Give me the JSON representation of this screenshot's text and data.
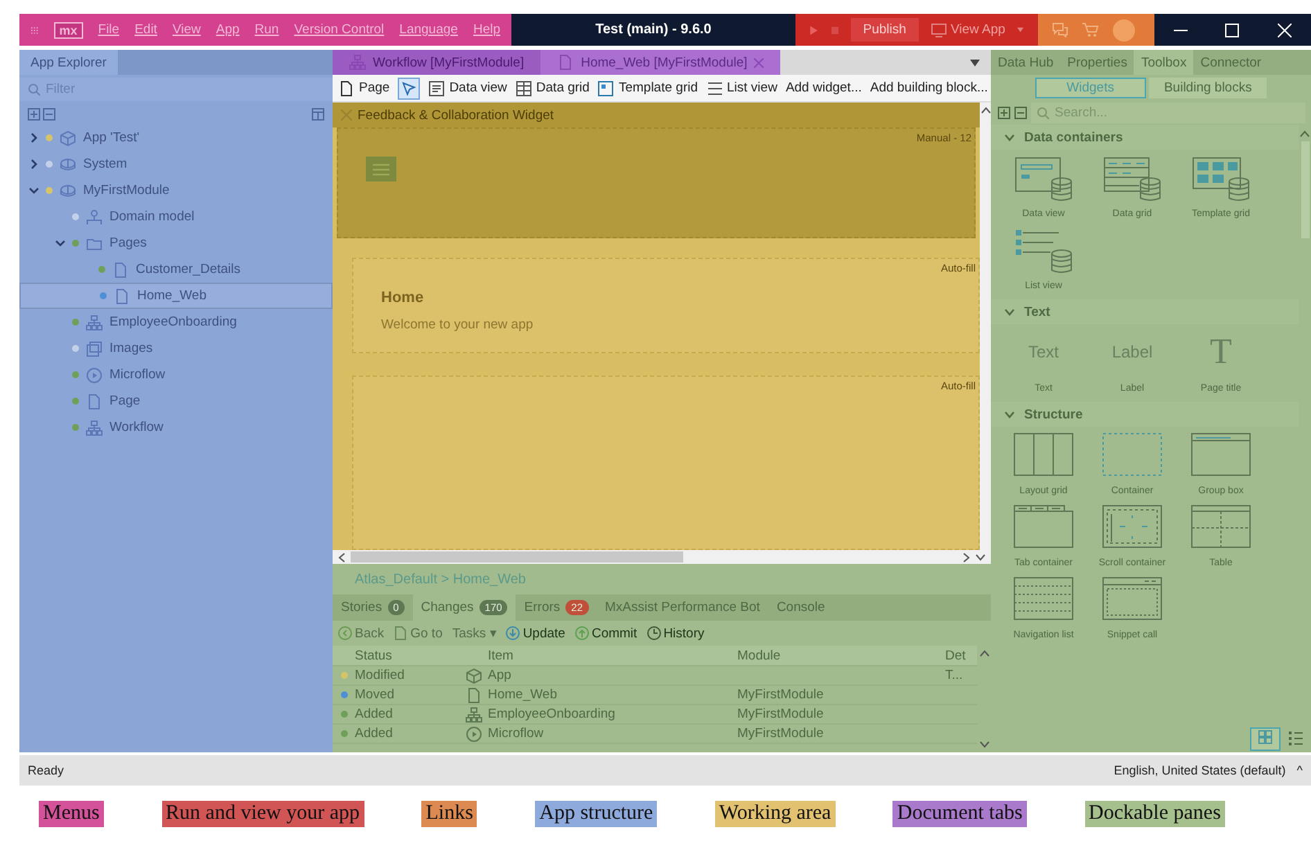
{
  "title_bar": {
    "logo": "mx",
    "menus": [
      "File",
      "Edit",
      "View",
      "App",
      "Run",
      "Version Control",
      "Language",
      "Help"
    ],
    "title": "Test (main)  -  9.6.0",
    "publish": "Publish",
    "view_app": "View App"
  },
  "app_explorer": {
    "title": "App Explorer",
    "filter_placeholder": "Filter",
    "tree": [
      {
        "label": "App 'Test'",
        "kind": "app",
        "color": "#d6c46a",
        "expanded": false,
        "selected": false
      },
      {
        "label": "System",
        "kind": "module",
        "color": "#c4cfe8",
        "expanded": false,
        "selected": false
      },
      {
        "label": "MyFirstModule",
        "kind": "module",
        "color": "#d6c46a",
        "expanded": true,
        "selected": false,
        "children": [
          {
            "label": "Domain model",
            "kind": "domain",
            "color": "#c4cfe8",
            "selected": false
          },
          {
            "label": "Pages",
            "kind": "folder",
            "color": "#6fa05a",
            "expanded": true,
            "selected": false,
            "children": [
              {
                "label": "Customer_Details",
                "kind": "page",
                "color": "#6fa05a",
                "selected": false
              },
              {
                "label": "Home_Web",
                "kind": "page",
                "color": "#4f8fd6",
                "selected": true
              }
            ]
          },
          {
            "label": "EmployeeOnboarding",
            "kind": "workflow",
            "color": "#6fa05a",
            "selected": false
          },
          {
            "label": "Images",
            "kind": "images",
            "color": "#c4cfe8",
            "selected": false
          },
          {
            "label": "Microflow",
            "kind": "microflow",
            "color": "#6fa05a",
            "selected": false
          },
          {
            "label": "Page",
            "kind": "page",
            "color": "#6fa05a",
            "selected": false
          },
          {
            "label": "Workflow",
            "kind": "workflow",
            "color": "#6fa05a",
            "selected": false
          }
        ]
      }
    ]
  },
  "document_tabs": [
    {
      "label": "Workflow [MyFirstModule]",
      "kind": "workflow",
      "selected": false
    },
    {
      "label": "Home_Web [MyFirstModule]",
      "kind": "page",
      "selected": true
    }
  ],
  "page_toolbar": [
    {
      "label": "Page",
      "kind": "page"
    },
    {
      "kind": "select"
    },
    {
      "label": "Data view",
      "kind": "dataview"
    },
    {
      "label": "Data grid",
      "kind": "datagrid"
    },
    {
      "label": "Template grid",
      "kind": "templategrid"
    },
    {
      "label": "List view",
      "kind": "listview"
    },
    {
      "label": "Add widget...",
      "kind": "text"
    },
    {
      "label": "Add building block...",
      "kind": "text"
    }
  ],
  "canvas": {
    "widget_bar": "Feedback & Collaboration Widget",
    "header_tag": "Manual - 12",
    "content_tag": "Auto-fill",
    "heading": "Home",
    "welcome": "Welcome to your new app",
    "footer_tag": "Auto-fill"
  },
  "bottom_pane": {
    "breadcrumb": "Atlas_Default > Home_Web",
    "tabs": [
      {
        "label": "Stories",
        "count": "0",
        "alert": false,
        "selected": false
      },
      {
        "label": "Changes",
        "count": "170",
        "alert": false,
        "selected": true
      },
      {
        "label": "Errors",
        "count": "22",
        "alert": true,
        "selected": false
      },
      {
        "label": "MxAssist Performance Bot",
        "selected": false
      },
      {
        "label": "Console",
        "selected": false
      }
    ],
    "actions": [
      {
        "label": "Back",
        "kind": "back",
        "disabled": true
      },
      {
        "label": "Go to",
        "kind": "goto",
        "disabled": true
      },
      {
        "label": "Tasks ▾",
        "kind": "plain",
        "disabled": true
      },
      {
        "label": "Update",
        "kind": "update",
        "disabled": false
      },
      {
        "label": "Commit",
        "kind": "commit",
        "disabled": false
      },
      {
        "label": "History",
        "kind": "history",
        "disabled": false
      }
    ],
    "columns": [
      "Status",
      "Item",
      "Module",
      "Det"
    ],
    "rows": [
      {
        "color": "#d6c46a",
        "status": "Modified",
        "kind": "app",
        "item": "App",
        "module": "",
        "detail": "T..."
      },
      {
        "color": "#4f8fd6",
        "status": "Moved",
        "kind": "page",
        "item": "Home_Web",
        "module": "MyFirstModule",
        "detail": ""
      },
      {
        "color": "#6fa05a",
        "status": "Added",
        "kind": "workflow",
        "item": "EmployeeOnboarding",
        "module": "MyFirstModule",
        "detail": ""
      },
      {
        "color": "#6fa05a",
        "status": "Added",
        "kind": "microflow",
        "item": "Microflow",
        "module": "MyFirstModule",
        "detail": ""
      }
    ]
  },
  "toolbox": {
    "tabs": [
      {
        "label": "Data Hub",
        "selected": false
      },
      {
        "label": "Properties",
        "selected": false
      },
      {
        "label": "Toolbox",
        "selected": true
      },
      {
        "label": "Connector",
        "selected": false
      }
    ],
    "modes": [
      {
        "label": "Widgets",
        "selected": true
      },
      {
        "label": "Building blocks",
        "selected": false
      }
    ],
    "search_placeholder": "Search...",
    "sections": [
      {
        "title": "Data containers",
        "items": [
          {
            "label": "Data view",
            "kind": "data_view"
          },
          {
            "label": "Data grid",
            "kind": "data_grid"
          },
          {
            "label": "Template grid",
            "kind": "template_grid"
          },
          {
            "label": "List view",
            "kind": "list_view"
          }
        ]
      },
      {
        "title": "Text",
        "items": [
          {
            "label": "Text",
            "kind": "preview",
            "preview": "Text"
          },
          {
            "label": "Label",
            "kind": "preview",
            "preview": "Label"
          },
          {
            "label": "Page title",
            "kind": "serif",
            "preview": "T"
          }
        ]
      },
      {
        "title": "Structure",
        "items": [
          {
            "label": "Layout grid",
            "kind": "layout_grid"
          },
          {
            "label": "Container",
            "kind": "container"
          },
          {
            "label": "Group box",
            "kind": "group_box"
          },
          {
            "label": "Tab container",
            "kind": "tab_container"
          },
          {
            "label": "Scroll container",
            "kind": "scroll_container"
          },
          {
            "label": "Table",
            "kind": "table"
          },
          {
            "label": "Navigation list",
            "kind": "navigation_list"
          },
          {
            "label": "Snippet call",
            "kind": "snippet_call"
          }
        ]
      }
    ]
  },
  "status_bar": {
    "text": "Ready",
    "language": "English, United States (default)",
    "arrow": "^"
  },
  "legend": [
    {
      "label": "Menus",
      "color": "#d4529a"
    },
    {
      "label": "Run and view your app",
      "color": "#d25555"
    },
    {
      "label": "Links",
      "color": "#dc8a52"
    },
    {
      "label": "App structure",
      "color": "#8eaadc"
    },
    {
      "label": "Working area",
      "color": "#e2c270"
    },
    {
      "label": "Document tabs",
      "color": "#a97acc"
    },
    {
      "label": "Dockable panes",
      "color": "#a5c08d"
    }
  ]
}
